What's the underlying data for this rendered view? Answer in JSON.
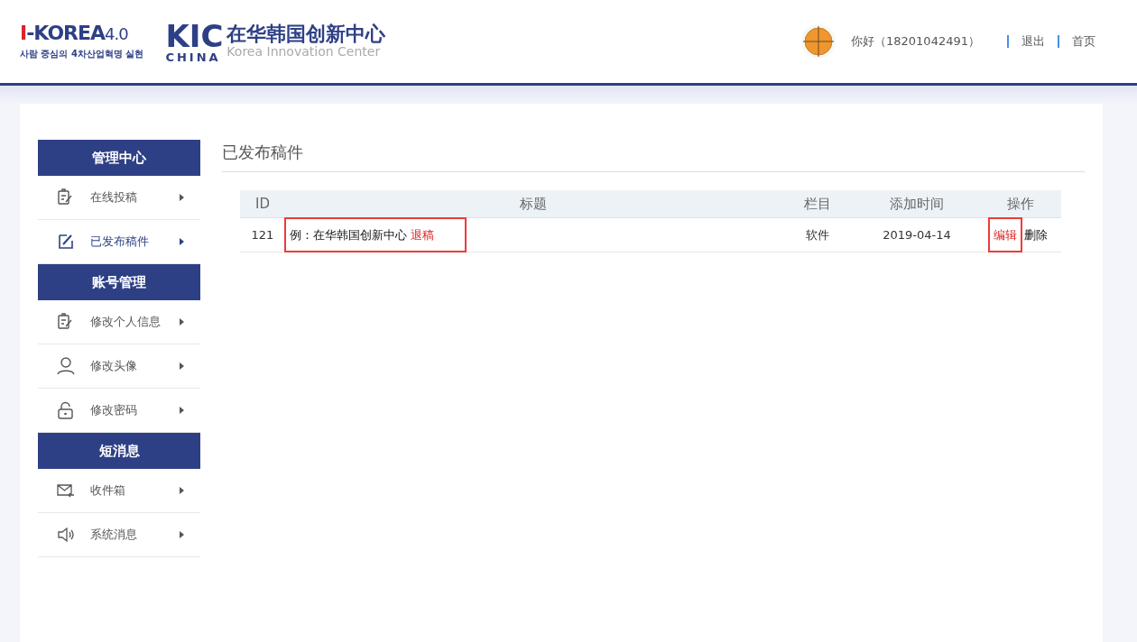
{
  "header": {
    "logo_left": {
      "mark_i": "I",
      "mark_rest": "-KOREA",
      "mark_version": "4.0",
      "tagline": "사람 중심의 4차산업혁명 실현"
    },
    "logo_right": {
      "kic": "KIC",
      "china": "CHINA",
      "name_cn": "在华韩国创新中心",
      "name_en": "Korea Innovation Center"
    },
    "greeting": "你好（18201042491）",
    "links": [
      "退出",
      "首页"
    ]
  },
  "sidebar": [
    {
      "title": "管理中心",
      "items": [
        {
          "label": "在线投稿",
          "kind": "clipboard",
          "selected": false
        },
        {
          "label": "已发布稿件",
          "kind": "edit",
          "selected": true
        }
      ]
    },
    {
      "title": "账号管理",
      "items": [
        {
          "label": "修改个人信息",
          "kind": "clipboard",
          "selected": false
        },
        {
          "label": "修改头像",
          "kind": "user",
          "selected": false
        },
        {
          "label": "修改密码",
          "kind": "lock",
          "selected": false
        }
      ]
    },
    {
      "title": "短消息",
      "items": [
        {
          "label": "收件箱",
          "kind": "mail",
          "selected": false
        },
        {
          "label": "系统消息",
          "kind": "speaker",
          "selected": false
        }
      ]
    }
  ],
  "content": {
    "title": "已发布稿件",
    "table": {
      "columns": [
        "ID",
        "标题",
        "栏目",
        "添加时间",
        "操作"
      ],
      "rows": [
        {
          "id": "121",
          "title": "例：在华韩国创新中心",
          "title_tag": "退稿",
          "category": "软件",
          "date": "2019-04-14",
          "actions": [
            {
              "label": "编辑",
              "highlighted": true
            },
            {
              "label": "删除",
              "highlighted": false
            }
          ],
          "title_highlighted": true
        }
      ]
    }
  }
}
